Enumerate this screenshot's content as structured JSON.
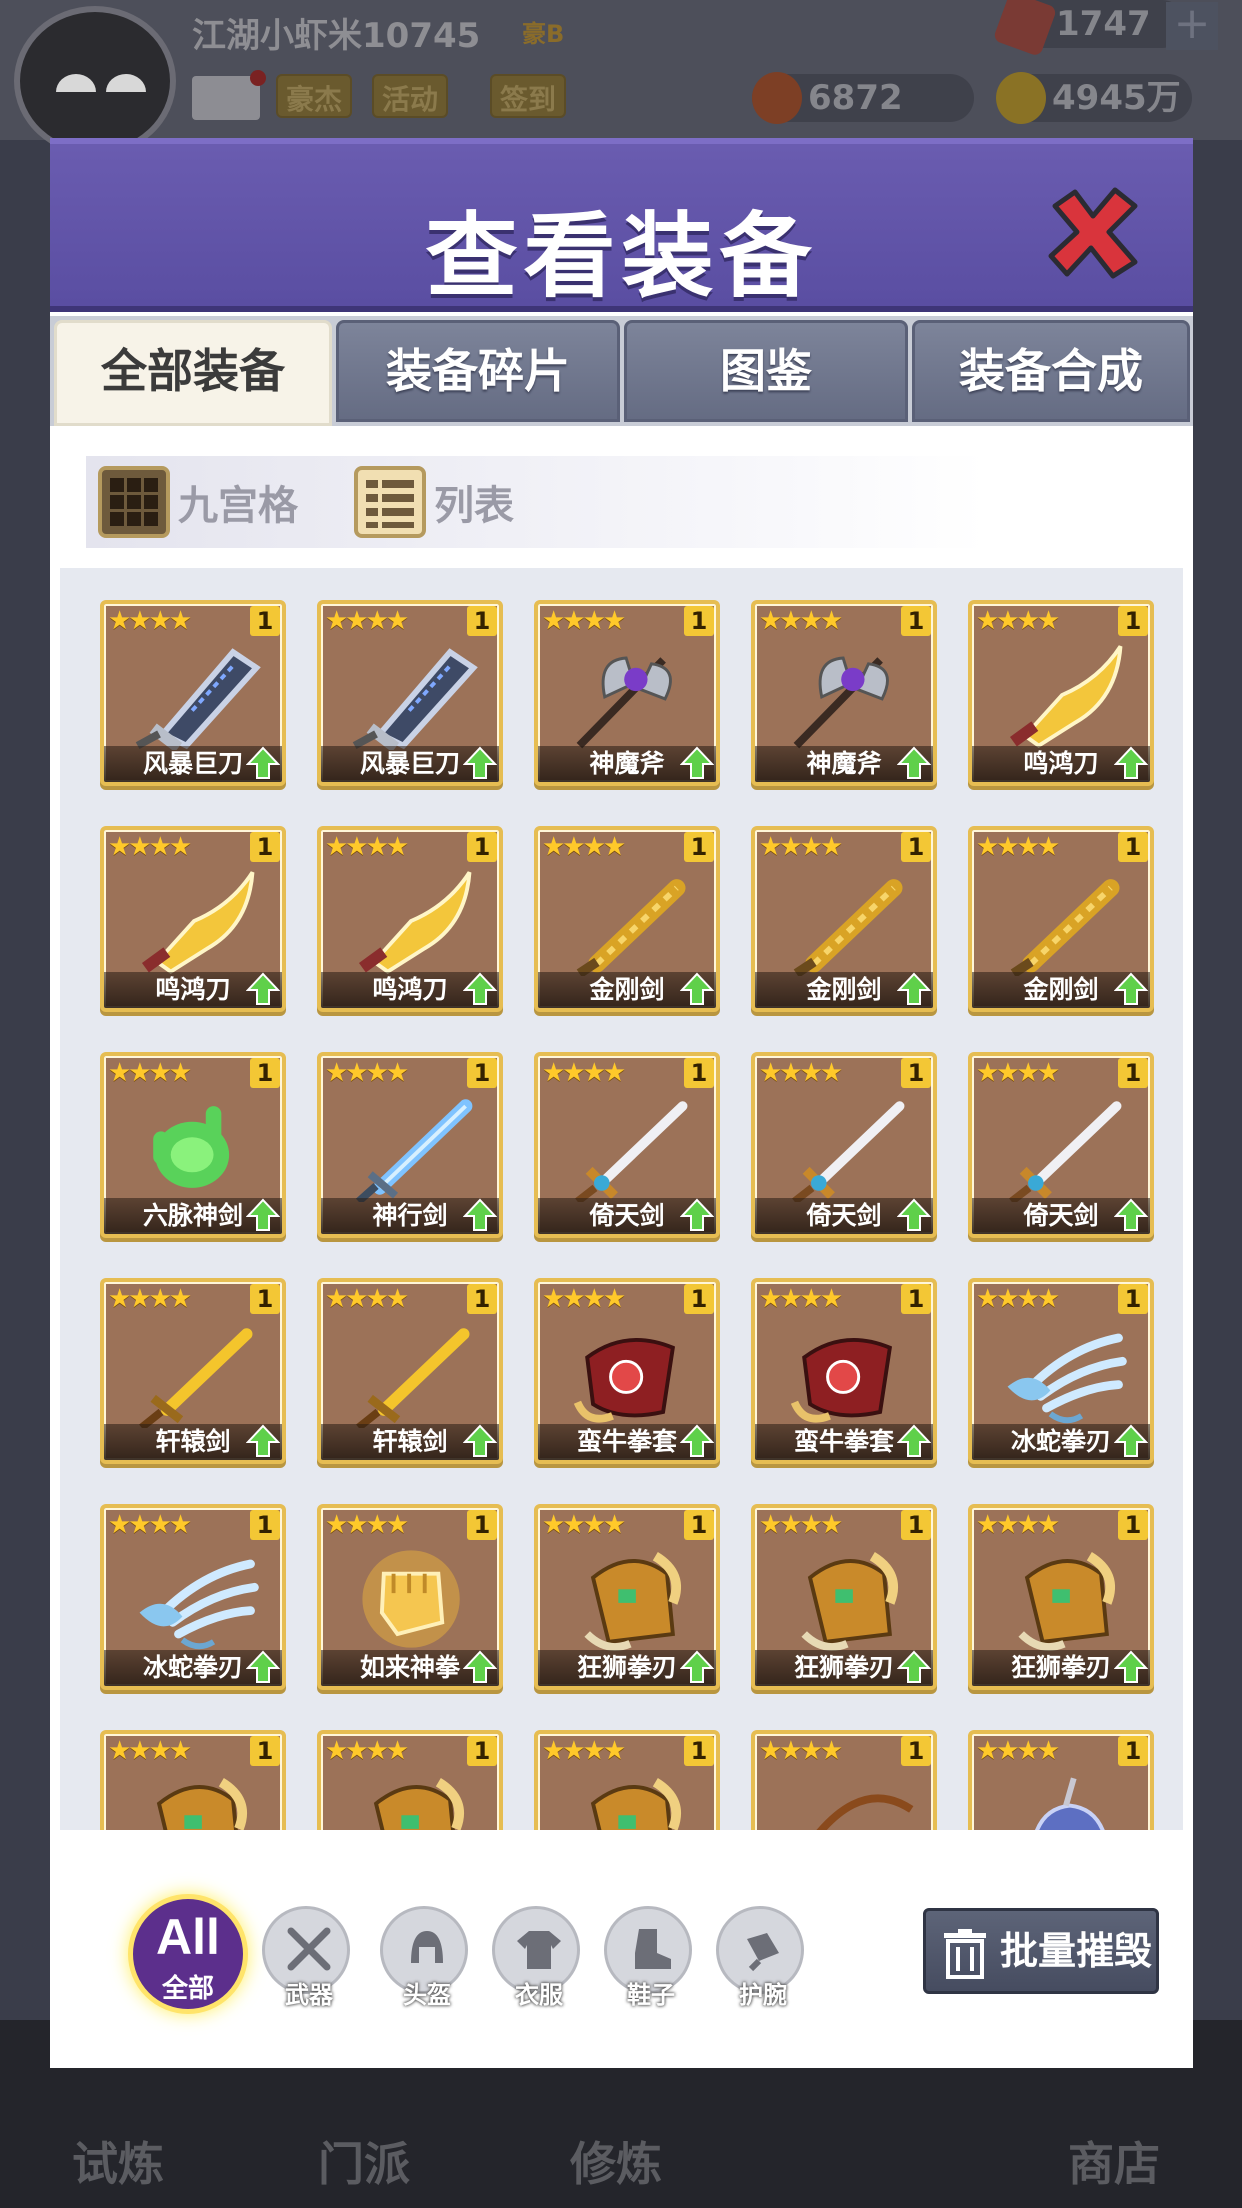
{
  "player": {
    "name": "江湖小虾米10745",
    "vip": "豪B",
    "top_buttons": [
      "豪杰",
      "活动",
      "签到"
    ],
    "gems": "1747",
    "tokens": "6872",
    "coins": "4945万"
  },
  "bottom_nav": [
    "试炼",
    "门派",
    "修炼",
    "商店"
  ],
  "dialog": {
    "title": "查看装备",
    "tabs": [
      "全部装备",
      "装备碎片",
      "图鉴",
      "装备合成"
    ],
    "active_tab": 0,
    "view_modes": [
      "九宫格",
      "列表"
    ],
    "items": [
      {
        "name": "风暴巨刀",
        "stars": "★★★★",
        "count": "1",
        "icon": "storm-blade-icon"
      },
      {
        "name": "风暴巨刀",
        "stars": "★★★★",
        "count": "1",
        "icon": "storm-blade-icon"
      },
      {
        "name": "神魔斧",
        "stars": "★★★★",
        "count": "1",
        "icon": "axe-icon"
      },
      {
        "name": "神魔斧",
        "stars": "★★★★",
        "count": "1",
        "icon": "axe-icon"
      },
      {
        "name": "鸣鸿刀",
        "stars": "★★★★",
        "count": "1",
        "icon": "golden-blade-icon"
      },
      {
        "name": "鸣鸿刀",
        "stars": "★★★★",
        "count": "1",
        "icon": "golden-blade-icon"
      },
      {
        "name": "鸣鸿刀",
        "stars": "★★★★",
        "count": "1",
        "icon": "golden-blade-icon"
      },
      {
        "name": "金刚剑",
        "stars": "★★★★",
        "count": "1",
        "icon": "gold-sword-icon"
      },
      {
        "name": "金刚剑",
        "stars": "★★★★",
        "count": "1",
        "icon": "gold-sword-icon"
      },
      {
        "name": "金刚剑",
        "stars": "★★★★",
        "count": "1",
        "icon": "gold-sword-icon"
      },
      {
        "name": "六脉神剑",
        "stars": "★★★★",
        "count": "1",
        "icon": "green-hand-icon"
      },
      {
        "name": "神行剑",
        "stars": "★★★★",
        "count": "1",
        "icon": "blue-sword-icon"
      },
      {
        "name": "倚天剑",
        "stars": "★★★★",
        "count": "1",
        "icon": "silver-sword-icon"
      },
      {
        "name": "倚天剑",
        "stars": "★★★★",
        "count": "1",
        "icon": "silver-sword-icon"
      },
      {
        "name": "倚天剑",
        "stars": "★★★★",
        "count": "1",
        "icon": "silver-sword-icon"
      },
      {
        "name": "轩辕剑",
        "stars": "★★★★",
        "count": "1",
        "icon": "yellow-sword-icon"
      },
      {
        "name": "轩辕剑",
        "stars": "★★★★",
        "count": "1",
        "icon": "yellow-sword-icon"
      },
      {
        "name": "蛮牛拳套",
        "stars": "★★★★",
        "count": "1",
        "icon": "red-gauntlet-icon"
      },
      {
        "name": "蛮牛拳套",
        "stars": "★★★★",
        "count": "1",
        "icon": "red-gauntlet-icon"
      },
      {
        "name": "冰蛇拳刃",
        "stars": "★★★★",
        "count": "1",
        "icon": "ice-claw-icon"
      },
      {
        "name": "冰蛇拳刃",
        "stars": "★★★★",
        "count": "1",
        "icon": "ice-claw-icon"
      },
      {
        "name": "如来神拳",
        "stars": "★★★★",
        "count": "1",
        "icon": "golden-fist-icon"
      },
      {
        "name": "狂狮拳刃",
        "stars": "★★★★",
        "count": "1",
        "icon": "lion-claw-icon"
      },
      {
        "name": "狂狮拳刃",
        "stars": "★★★★",
        "count": "1",
        "icon": "lion-claw-icon"
      },
      {
        "name": "狂狮拳刃",
        "stars": "★★★★",
        "count": "1",
        "icon": "lion-claw-icon"
      },
      {
        "name": "",
        "stars": "★★★★",
        "count": "1",
        "icon": "lion-claw-icon"
      },
      {
        "name": "",
        "stars": "★★★★",
        "count": "1",
        "icon": "lion-claw-icon"
      },
      {
        "name": "",
        "stars": "★★★★",
        "count": "1",
        "icon": "lion-claw-icon"
      },
      {
        "name": "",
        "stars": "★★★★",
        "count": "1",
        "icon": "bow-icon"
      },
      {
        "name": "",
        "stars": "★★★★",
        "count": "1",
        "icon": "helmet-icon"
      }
    ],
    "filter": {
      "all_big": "All",
      "all_small": "全部",
      "categories": [
        "武器",
        "头盔",
        "衣服",
        "鞋子",
        "护腕"
      ]
    },
    "destroy_label": "批量摧毁"
  },
  "colors": {
    "header": "#5a4ea2",
    "card_border": "#e6bd52",
    "star": "#ffc92a",
    "upgrade": "#5fd04a"
  }
}
